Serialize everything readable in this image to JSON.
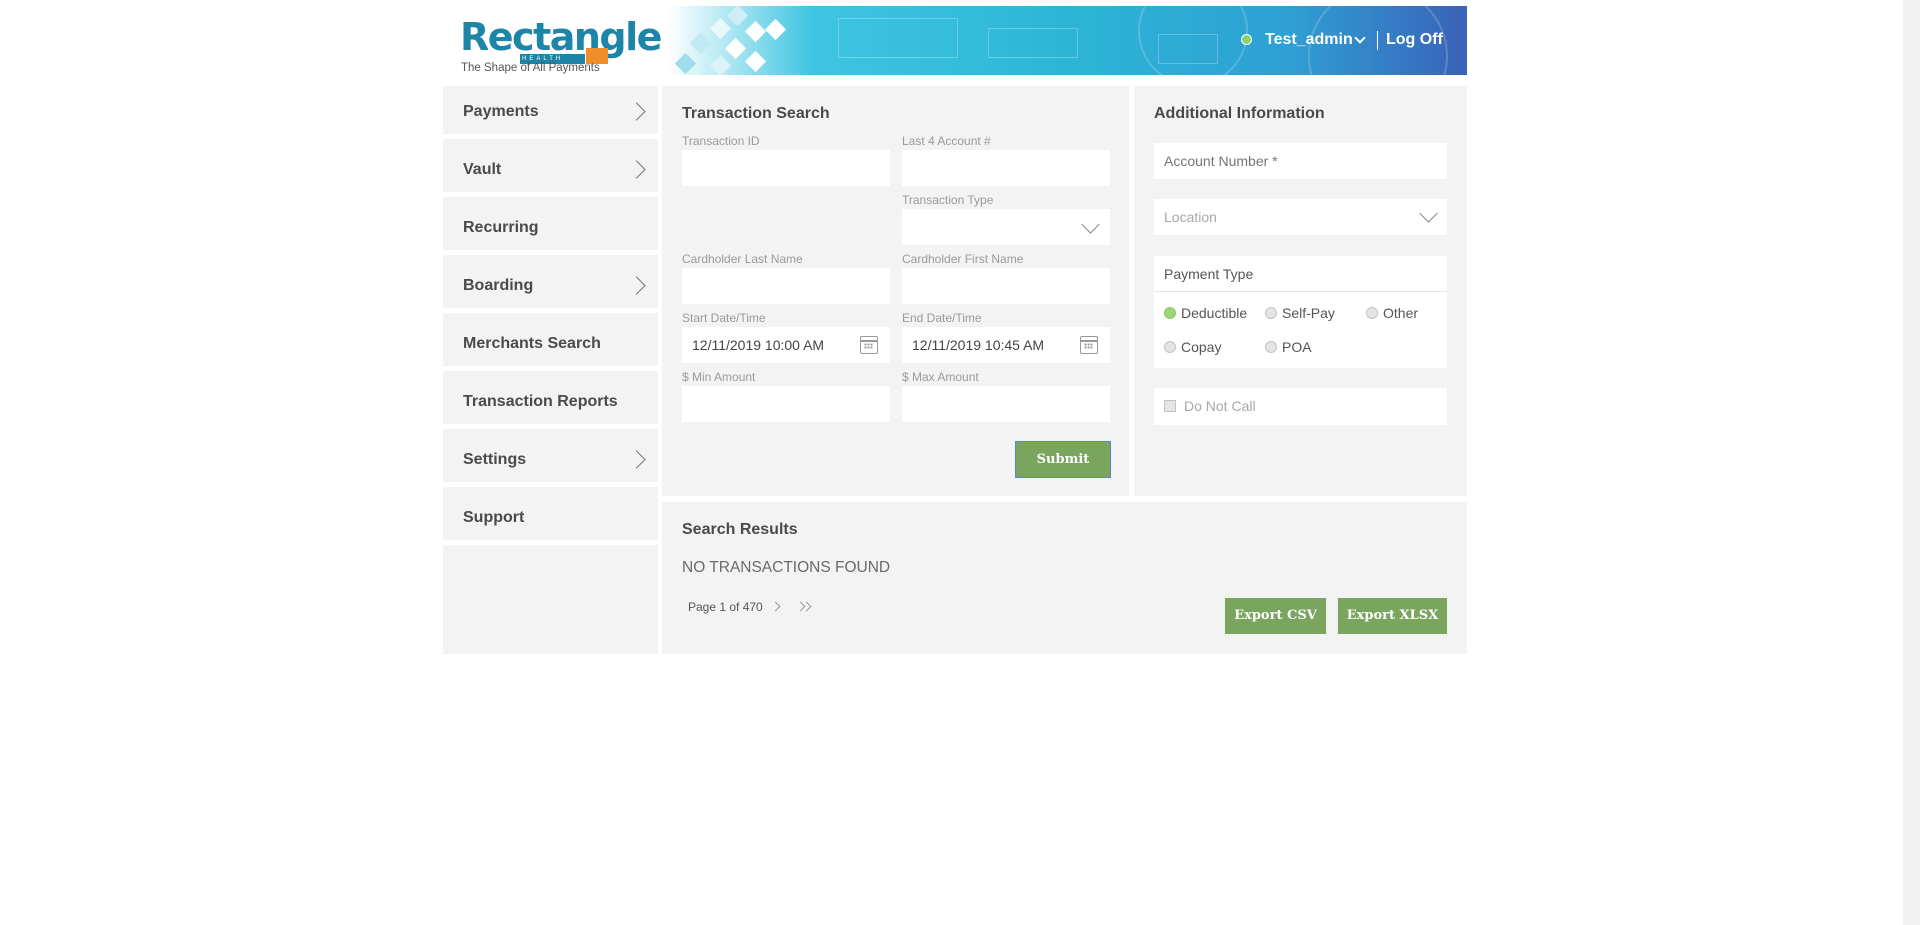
{
  "header": {
    "logo_text": "Rectangle",
    "logo_sub": "HEALTH",
    "tagline": "The Shape of All Payments",
    "user_name": "Test_admin",
    "logoff_label": "Log Off"
  },
  "sidebar": {
    "items": [
      {
        "label": "Payments",
        "has_submenu": true
      },
      {
        "label": "Vault",
        "has_submenu": true
      },
      {
        "label": "Recurring",
        "has_submenu": false
      },
      {
        "label": "Boarding",
        "has_submenu": true
      },
      {
        "label": "Merchants Search",
        "has_submenu": false
      },
      {
        "label": "Transaction Reports",
        "has_submenu": false
      },
      {
        "label": "Settings",
        "has_submenu": true
      },
      {
        "label": "Support",
        "has_submenu": false
      }
    ]
  },
  "search": {
    "title": "Transaction Search",
    "transaction_id_label": "Transaction ID",
    "transaction_id_value": "",
    "last4_label": "Last 4 Account #",
    "last4_value": "",
    "transaction_type_label": "Transaction Type",
    "transaction_type_value": "",
    "last_name_label": "Cardholder Last Name",
    "last_name_value": "",
    "first_name_label": "Cardholder First Name",
    "first_name_value": "",
    "start_label": "Start Date/Time",
    "start_value": "12/11/2019 10:00 AM",
    "end_label": "End Date/Time",
    "end_value": "12/11/2019 10:45 AM",
    "min_label": "$ Min Amount",
    "min_value": "",
    "max_label": "$ Max Amount",
    "max_value": "",
    "submit_label": "Submit"
  },
  "additional": {
    "title": "Additional Information",
    "account_placeholder": "Account Number *",
    "location_placeholder": "Location",
    "payment_type_title": "Payment Type",
    "payment_types": [
      {
        "label": "Deductible",
        "selected": true
      },
      {
        "label": "Self-Pay",
        "selected": false
      },
      {
        "label": "Other",
        "selected": false
      },
      {
        "label": "Copay",
        "selected": false
      },
      {
        "label": "POA",
        "selected": false
      }
    ],
    "do_not_call_label": "Do Not Call",
    "do_not_call_checked": false
  },
  "results": {
    "title": "Search Results",
    "empty_message": "NO TRANSACTIONS FOUND",
    "pager_text": "Page 1 of 470",
    "export_csv_label": "Export CSV",
    "export_xlsx_label": "Export XLSX"
  },
  "colors": {
    "accent_green": "#7aa55f",
    "brand_blue": "#1d86a8",
    "brand_orange": "#f28c28",
    "panel_bg": "#f3f3f3",
    "status_online": "#8fd16f"
  }
}
